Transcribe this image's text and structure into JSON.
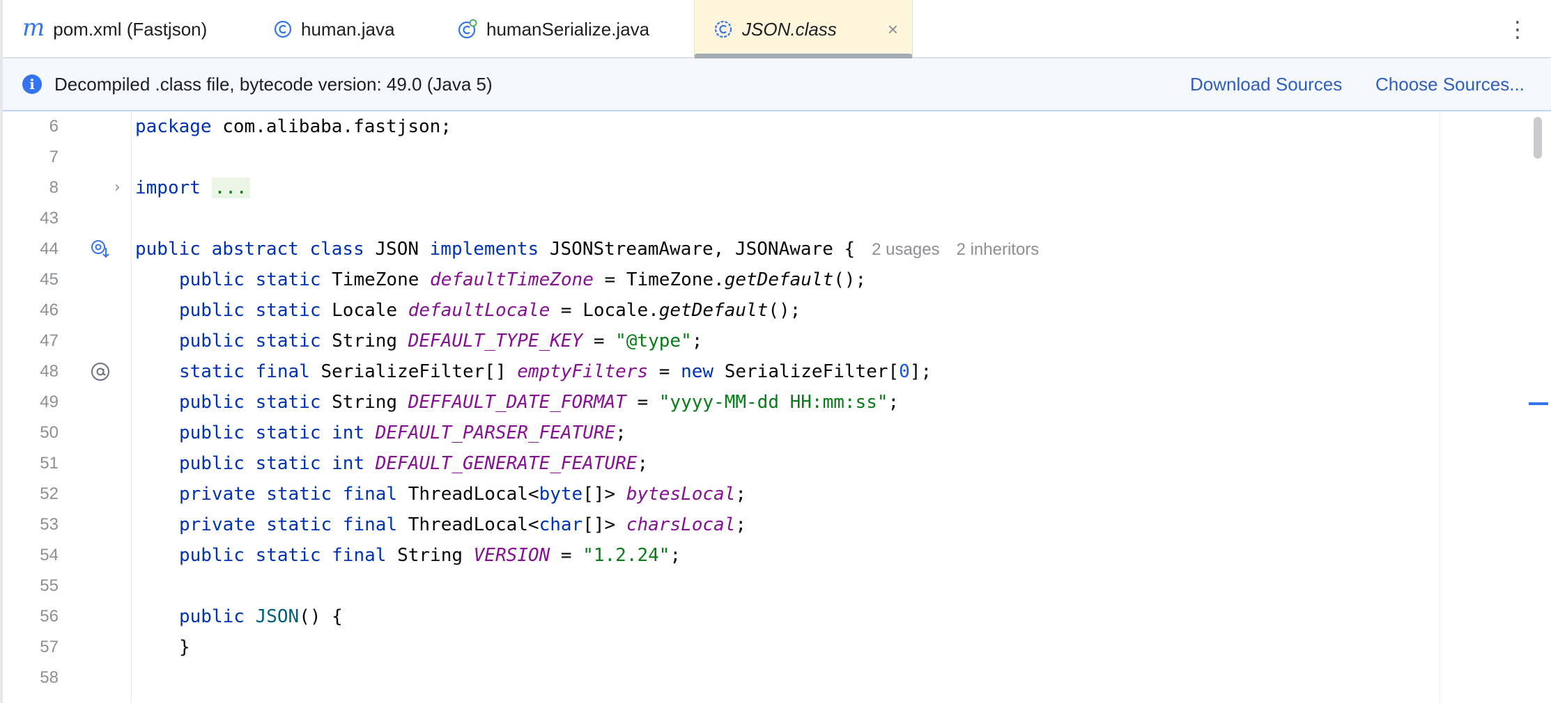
{
  "tabs": [
    {
      "label": "pom.xml (Fastjson)",
      "icon": "maven-m-icon"
    },
    {
      "label": "human.java",
      "icon": "class-c-icon"
    },
    {
      "label": "humanSerialize.java",
      "icon": "class-c-modified-icon"
    },
    {
      "label": "JSON.class",
      "icon": "class-c-icon",
      "active": true,
      "close": "×"
    }
  ],
  "tab_menu": "⋮",
  "banner": {
    "message": "Decompiled .class file, bytecode version: 49.0 (Java 5)",
    "download_link": "Download Sources",
    "choose_link": "Choose Sources..."
  },
  "code": {
    "l6": {
      "num": "6",
      "kw1": "package",
      "rest": " com.alibaba.fastjson;"
    },
    "l7": {
      "num": "7"
    },
    "l8": {
      "num": "8",
      "kw1": "import",
      "fold": "..."
    },
    "l43": {
      "num": "43"
    },
    "l44": {
      "num": "44",
      "kw1": "public abstract class",
      "name": " JSON ",
      "kw2": "implements",
      "rest": " JSONStreamAware, JSONAware {",
      "usages": "2 usages",
      "inheritors": "2 inheritors"
    },
    "l45": {
      "num": "45",
      "kw": "public static",
      "type": " TimeZone ",
      "field": "defaultTimeZone",
      "mid": " = TimeZone.",
      "method": "getDefault",
      "end": "();"
    },
    "l46": {
      "num": "46",
      "kw": "public static",
      "type": " Locale ",
      "field": "defaultLocale",
      "mid": " = Locale.",
      "method": "getDefault",
      "end": "();"
    },
    "l47": {
      "num": "47",
      "kw": "public static",
      "type": " String ",
      "field": "DEFAULT_TYPE_KEY",
      "mid": " = ",
      "str": "\"@type\"",
      "end": ";"
    },
    "l48": {
      "num": "48",
      "kw": "static final",
      "type": " SerializeFilter[] ",
      "field": "emptyFilters",
      "mid": " = ",
      "kwnew": "new",
      "mid2": " SerializeFilter[",
      "n": "0",
      "end": "];"
    },
    "l49": {
      "num": "49",
      "kw": "public static",
      "type": " String ",
      "field": "DEFFAULT_DATE_FORMAT",
      "mid": " = ",
      "str": "\"yyyy-MM-dd HH:mm:ss\"",
      "end": ";"
    },
    "l50": {
      "num": "50",
      "kw": "public static int",
      "field": "DEFAULT_PARSER_FEATURE",
      "end": ";"
    },
    "l51": {
      "num": "51",
      "kw": "public static int",
      "field": "DEFAULT_GENERATE_FEATURE",
      "end": ";"
    },
    "l52": {
      "num": "52",
      "kw": "private static final",
      "type": " ThreadLocal<",
      "kwb": "byte",
      "type2": "[]> ",
      "field": "bytesLocal",
      "end": ";"
    },
    "l53": {
      "num": "53",
      "kw": "private static final",
      "type": " ThreadLocal<",
      "kwb": "char",
      "type2": "[]> ",
      "field": "charsLocal",
      "end": ";"
    },
    "l54": {
      "num": "54",
      "kw": "public static final",
      "type": " String ",
      "field": "VERSION",
      "mid": " = ",
      "str": "\"1.2.24\"",
      "end": ";"
    },
    "l55": {
      "num": "55"
    },
    "l56": {
      "num": "56",
      "kw": "public",
      "ctor": "JSON",
      "end": "() {"
    },
    "l57": {
      "num": "57",
      "end": "}"
    },
    "l58": {
      "num": "58"
    }
  }
}
